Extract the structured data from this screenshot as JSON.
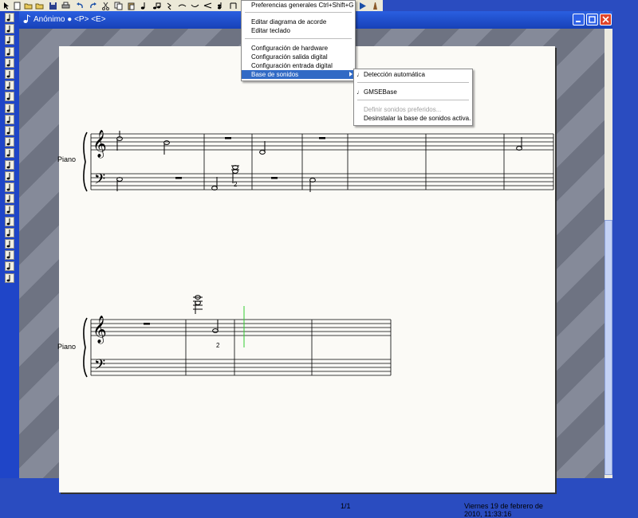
{
  "window": {
    "title": "Anónimo ● <P> <E>"
  },
  "score": {
    "instrument_label_1": "Piano",
    "instrument_label_2": "Piano",
    "fingering_1": "2",
    "fingering_2": "2",
    "footer_page": "1/1",
    "footer_date": "Viernes 19 de febrero de 2010, 11:33:16"
  },
  "menu": {
    "items": [
      "Preferencias generales Ctrl+Shift+G",
      "Editar diagrama de acorde",
      "Editar teclado",
      "Configuración de hardware",
      "Configuración salida digital",
      "Configuración entrada digital",
      "Base de sonidos"
    ]
  },
  "submenu": {
    "items": [
      "Detección automática",
      "GMSEBase",
      "Definir sonidos preferidos...",
      "Desinstalar la base de sonidos activa."
    ],
    "checked_mark": "♩"
  },
  "colors": {
    "accent": "#316ac5",
    "titlebar": "#1f4ec9",
    "cursor": "#33cc33"
  }
}
